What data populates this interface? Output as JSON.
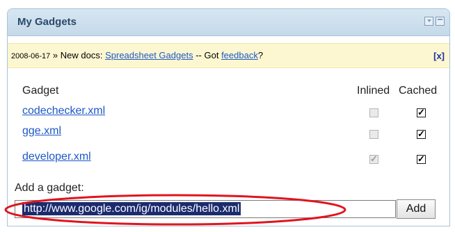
{
  "header": {
    "title": "My Gadgets",
    "min_icon": "collapse-icon",
    "max_icon": "maximize-icon"
  },
  "news": {
    "date": "2008-06-17",
    "separator": "»",
    "text1": "New docs:",
    "link1": "Spreadsheet Gadgets",
    "text2": "-- Got",
    "link2": "feedback",
    "text3": "?",
    "close_label": "[x]"
  },
  "table": {
    "headers": {
      "gadget": "Gadget",
      "inlined": "Inlined",
      "cached": "Cached"
    },
    "rows": [
      {
        "name": "codechecker.xml",
        "inlined": false,
        "inlined_enabled": false,
        "cached": true
      },
      {
        "name": "gge.xml",
        "inlined": false,
        "inlined_enabled": false,
        "cached": true
      },
      {
        "name": "developer.xml",
        "inlined": true,
        "inlined_enabled": false,
        "cached": true
      }
    ]
  },
  "add": {
    "label": "Add a gadget:",
    "url_value": "http://www.google.com/ig/modules/hello.xml",
    "button_label": "Add"
  },
  "colors": {
    "link": "#1c58c8",
    "highlight": "#e0141e",
    "selection": "#1b2b6e",
    "news_bg": "#fdf7d1",
    "titlebar": "#c5d9ea"
  }
}
